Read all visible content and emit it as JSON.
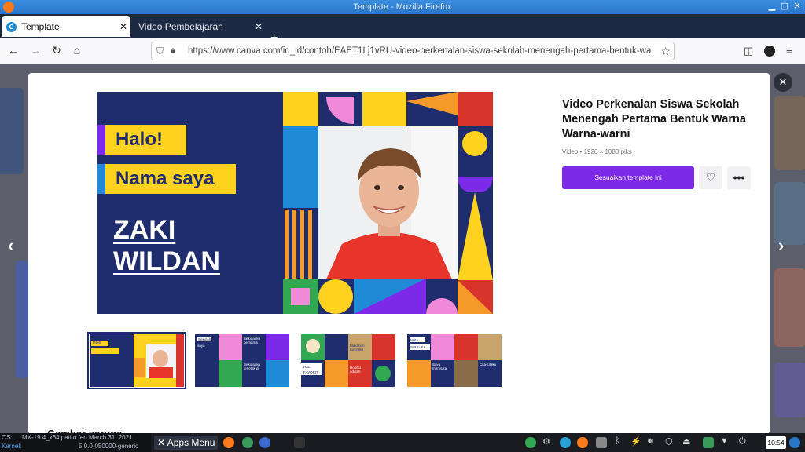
{
  "window": {
    "title": "Template - Mozilla Firefox"
  },
  "tabs": [
    {
      "label": "Template",
      "active": true
    },
    {
      "label": "Video Pembelajaran",
      "active": false
    }
  ],
  "nav": {
    "url": "https://www.canva.com/id_id/contoh/EAET1Lj1vRU-video-perkenalan-siswa-sekolah-menengah-pertama-bentuk-wa"
  },
  "template": {
    "title": "Video Perkenalan Siswa Sekolah Menengah Pertama Bentuk Warna Warna-warni",
    "meta": "Video • 1920 × 1080 piks",
    "primary_button": "Sesuaikan template ini",
    "like_icon": "heart-icon",
    "more_icon": "more-icon"
  },
  "preview": {
    "greeting": "Halo!",
    "intro": "Nama saya",
    "name_line1": "ZAKI",
    "name_line2": "WILDAN"
  },
  "thumbs": [
    {
      "label_a": "Halo",
      "selected": true
    },
    {
      "label_a": "Sekolah",
      "label_b": "saya",
      "label_c": "Sekolahku bernama",
      "label_d": "Sekolahku terletak di"
    },
    {
      "label_a": "HAL",
      "label_b": "FAVORIT",
      "label_c": "Makanan favoritku",
      "label_d": "Hobiku adalah"
    },
    {
      "label_a": "Mata",
      "label_b": "SIRSUKI",
      "label_c": "Saya menyukai",
      "label_d": "Cita-citaku"
    }
  ],
  "section": {
    "heading": "Gambar serupa"
  },
  "taskbar": {
    "os_label": "OS:",
    "os_value": "MX-19.4_x64 patito feo March 31, 2021",
    "kernel_label": "Kernel:",
    "kernel_value": "5.0.0-050000-generic",
    "apps_menu": "Apps Menu",
    "clock": "10:54"
  },
  "colors": {
    "navy": "#1f2d6e",
    "yellow": "#ffd21f",
    "purple": "#7d2ae8",
    "pink": "#f08ad8",
    "red": "#d9342b",
    "green": "#32a852",
    "blue": "#1f8bd6",
    "orange": "#f59a2a"
  }
}
